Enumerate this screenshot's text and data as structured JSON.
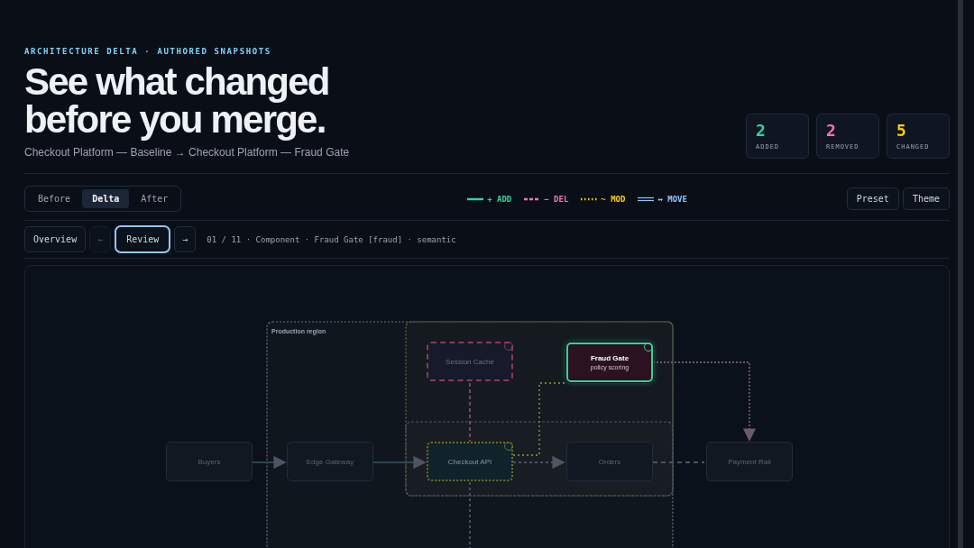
{
  "header": {
    "eyebrow": "ARCHITECTURE DELTA · AUTHORED SNAPSHOTS",
    "title_lines": [
      "See what changed",
      "before you merge."
    ],
    "subtitle": "Checkout Platform — Baseline → Checkout Platform — Fraud Gate"
  },
  "stats": [
    {
      "value": "2",
      "label": "ADDED",
      "color": "#34d399"
    },
    {
      "value": "2",
      "label": "REMOVED",
      "color": "#f472b6"
    },
    {
      "value": "5",
      "label": "CHANGED",
      "color": "#facc15"
    }
  ],
  "view_tabs": [
    {
      "label": "Before",
      "selected": false
    },
    {
      "label": "Delta",
      "selected": true
    },
    {
      "label": "After",
      "selected": false
    }
  ],
  "legend": [
    {
      "kind": "add",
      "label": "+ ADD",
      "color": "#34d399"
    },
    {
      "kind": "del",
      "label": "− DEL",
      "color": "#f472b6"
    },
    {
      "kind": "mod",
      "label": "~ MOD",
      "color": "#facc15"
    },
    {
      "kind": "move",
      "label": "↔ MOVE",
      "color": "#93c5fd"
    }
  ],
  "actions": [
    "Preset",
    "Theme"
  ],
  "review_bar": {
    "modes": [
      {
        "label": "Overview",
        "selected": false
      },
      {
        "label": "Review",
        "selected": true
      }
    ],
    "prev": "←",
    "next": "→",
    "position": "01 / 11 · Component · Fraud Gate [fraud] · semantic"
  },
  "diagram": {
    "zones": [
      {
        "label": "Production region"
      }
    ],
    "nodes": [
      {
        "name": "Session Cache",
        "kind": "removed",
        "focused": false
      },
      {
        "name": "Fraud Gate",
        "subtitle": "policy scoring",
        "kind": "added",
        "focused": true
      },
      {
        "name": "Buyers",
        "kind": "unchanged",
        "focused": false
      },
      {
        "name": "Edge Gateway",
        "kind": "unchanged",
        "focused": false
      },
      {
        "name": "Checkout API",
        "kind": "modified",
        "focused": false
      },
      {
        "name": "Orders",
        "kind": "unchanged",
        "focused": false
      },
      {
        "name": "Payment Rail",
        "kind": "unchanged",
        "focused": false
      }
    ]
  }
}
